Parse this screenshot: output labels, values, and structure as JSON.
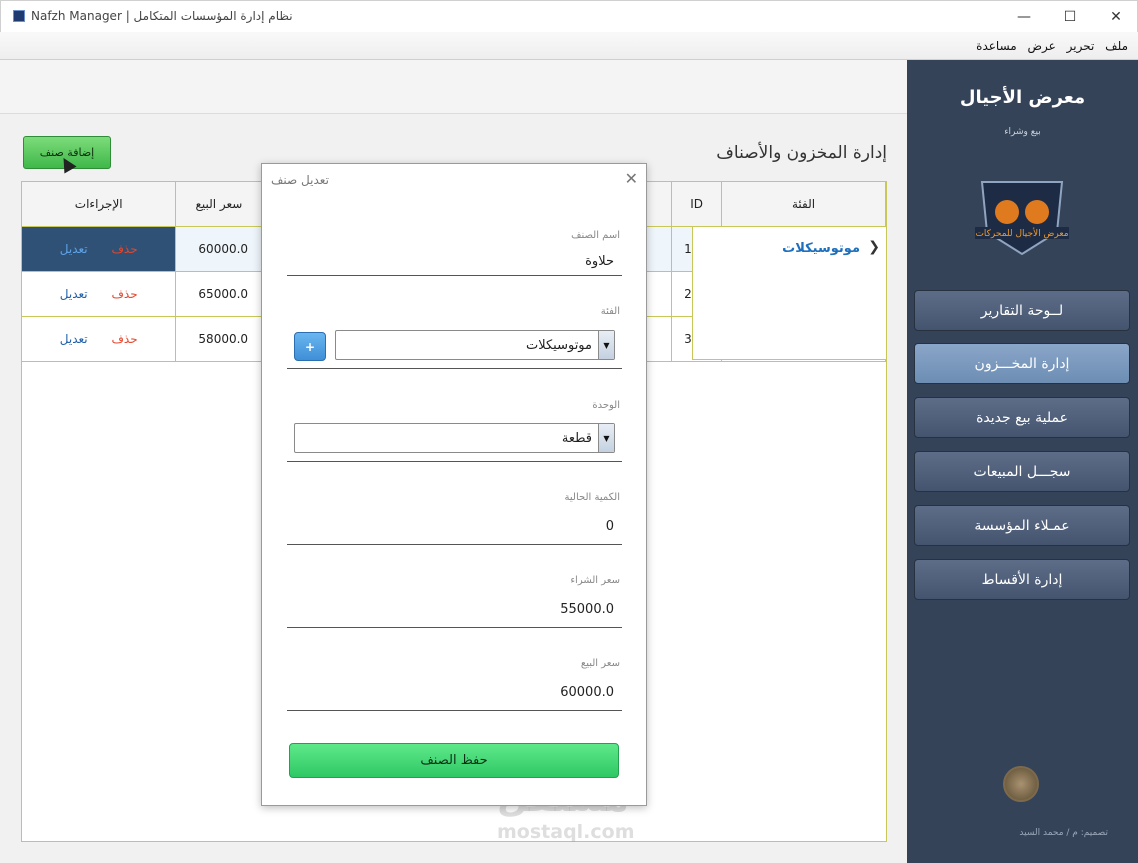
{
  "window": {
    "title": "Nafzh Manager | نظام إدارة المؤسسات المتكامل",
    "minimize": "—",
    "maximize": "☐",
    "close": "✕"
  },
  "menu": {
    "items": [
      "ملف",
      "تحرير",
      "عرض",
      "مساعدة"
    ]
  },
  "main": {
    "page_title": "إدارة المخزون والأصناف",
    "add_button": "إضافة صنف",
    "table": {
      "headers": {
        "actions": "الإجراءات",
        "price": "سعر البيع",
        "id": "ID",
        "category": "الفئة"
      },
      "rows": [
        {
          "id": "1",
          "price": "60000.0",
          "delete": "حذف",
          "edit": "تعديل"
        },
        {
          "id": "2",
          "price": "65000.0",
          "delete": "حذف",
          "edit": "تعديل"
        },
        {
          "id": "3",
          "price": "58000.0",
          "delete": "حذف",
          "edit": "تعديل"
        }
      ],
      "category_group": "موتوسيكلات"
    }
  },
  "sidebar": {
    "brand": "معرض الأجيال",
    "tagline": "بيع وشراء",
    "logo_text": "معرض الأجيال للمحركات",
    "nav": [
      "لــوحة التقارير",
      "إدارة المخـــزون",
      "عملية بيع جديدة",
      "سجـــل المبيعات",
      "عمـلاء المؤسسة",
      "إدارة الأقساط"
    ],
    "designer": "تصميم: م / محمد السيد"
  },
  "dialog": {
    "title": "تعديل صنف",
    "close": "✕",
    "name_label": "اسم الصنف",
    "name_value": "حلاوة",
    "category_label": "الفئة",
    "category_value": "موتوسيكلات",
    "add_category": "+",
    "unit_label": "الوحدة",
    "unit_value": "قطعة",
    "qty_label": "الكمية الحالية",
    "qty_value": "0",
    "buy_label": "سعر الشراء",
    "buy_value": "55000.0",
    "sell_label": "سعر البيع",
    "sell_value": "60000.0",
    "save_button": "حفظ الصنف"
  },
  "watermark": {
    "arabic": "مستقل",
    "latin": "mostaql.com"
  },
  "colors": {
    "sidebar": "#354359",
    "accent_green": "#3fb84a",
    "selection": "#2e5175",
    "table_border": "#c8c85a"
  }
}
